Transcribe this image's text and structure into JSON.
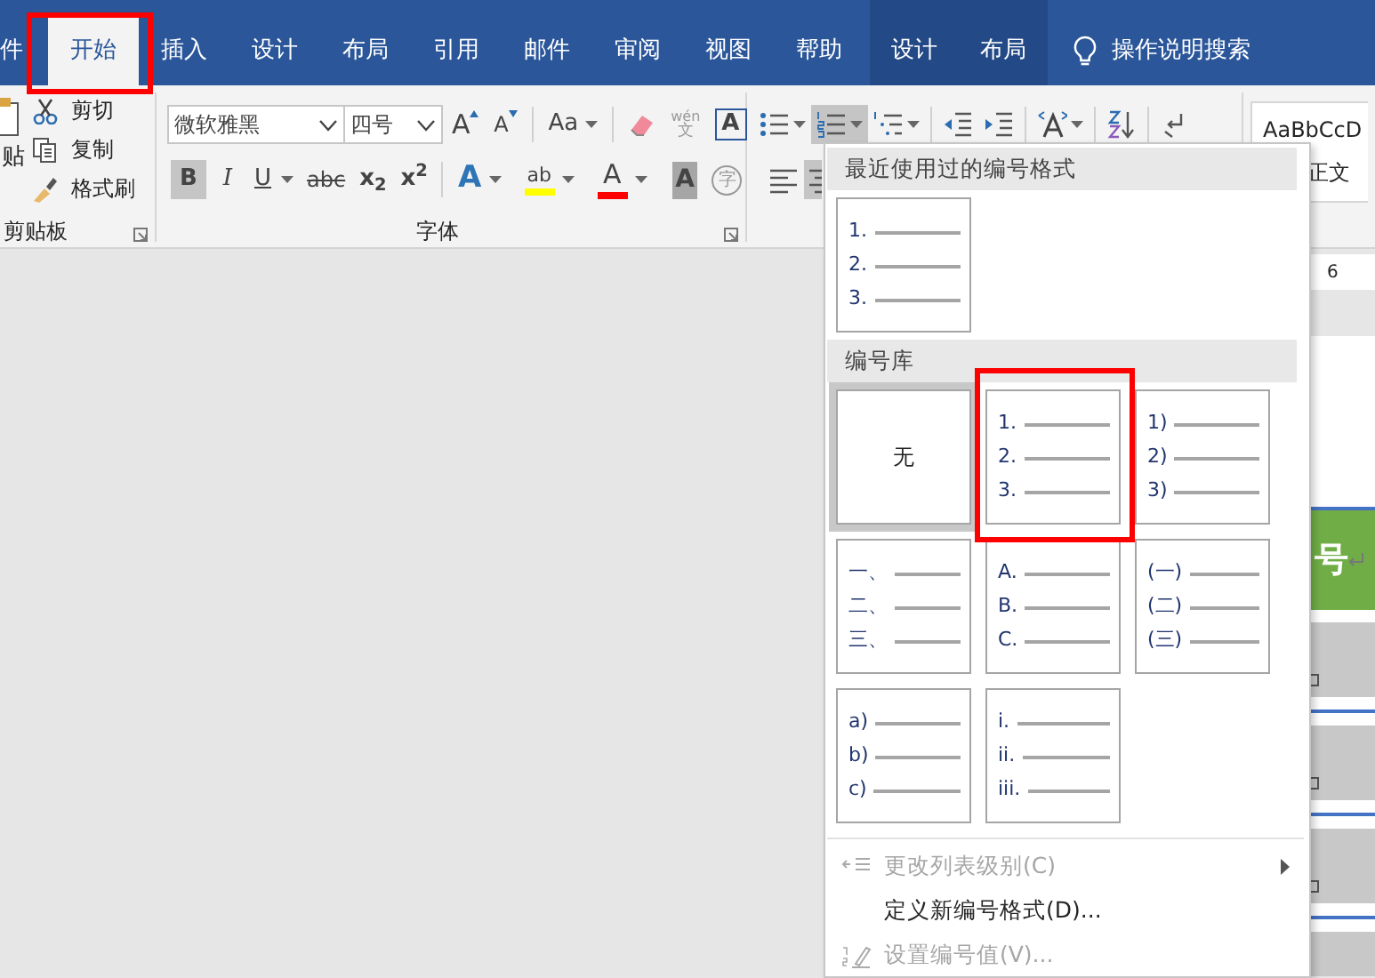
{
  "tabs": [
    {
      "label": "件",
      "selected": false,
      "kind": "tab"
    },
    {
      "label": "开始",
      "selected": true,
      "kind": "tab"
    },
    {
      "label": "插入",
      "selected": false,
      "kind": "tab"
    },
    {
      "label": "设计",
      "selected": false,
      "kind": "tab"
    },
    {
      "label": "布局",
      "selected": false,
      "kind": "tab"
    },
    {
      "label": "引用",
      "selected": false,
      "kind": "tab"
    },
    {
      "label": "邮件",
      "selected": false,
      "kind": "tab"
    },
    {
      "label": "审阅",
      "selected": false,
      "kind": "tab"
    },
    {
      "label": "视图",
      "selected": false,
      "kind": "tab"
    },
    {
      "label": "帮助",
      "selected": false,
      "kind": "tab"
    },
    {
      "label": "设计",
      "selected": false,
      "kind": "context"
    },
    {
      "label": "布局",
      "selected": false,
      "kind": "context"
    }
  ],
  "search": {
    "label": "操作说明搜索"
  },
  "clipboard": {
    "paste_label": "贴",
    "items": [
      {
        "kind": "cut",
        "label": "剪切"
      },
      {
        "kind": "copy",
        "label": "复制"
      },
      {
        "kind": "painter",
        "label": "格式刷"
      }
    ],
    "label": "剪贴板"
  },
  "font": {
    "name": "微软雅黑",
    "size": "四号",
    "label": "字体",
    "row1": [
      {
        "kind": "grow",
        "label": "A"
      },
      {
        "kind": "shrink",
        "label": "A"
      },
      {
        "kind": "case",
        "label": "Aa"
      },
      {
        "kind": "clear"
      },
      {
        "kind": "phonetic",
        "label": "wén",
        "sub": "文"
      },
      {
        "kind": "border",
        "label": "A"
      }
    ],
    "row2": [
      {
        "kind": "bold",
        "label": "B",
        "selected": true
      },
      {
        "kind": "italic",
        "label": "I",
        "selected": false
      },
      {
        "kind": "underline",
        "label": "U",
        "selected": false
      },
      {
        "kind": "strike",
        "label": "abc",
        "selected": false
      },
      {
        "kind": "subscript",
        "label": "x$_{2}$",
        "selected": false
      },
      {
        "kind": "superscript",
        "label": "x$^{2}$",
        "selected": false
      },
      {
        "kind": "effect",
        "label": "A"
      },
      {
        "kind": "highlight",
        "label": "ab",
        "color": "#ffff00"
      },
      {
        "kind": "fontcolor",
        "label": "A",
        "color": "#ff0000"
      },
      {
        "kind": "shading",
        "label": "A"
      },
      {
        "kind": "enclose",
        "label": "字"
      }
    ]
  },
  "paragraph": {
    "row1": [
      {
        "kind": "bullets",
        "selected": false
      },
      {
        "kind": "numbering",
        "selected": true
      },
      {
        "kind": "multilevel",
        "selected": false
      },
      {
        "kind": "outdent",
        "selected": false
      },
      {
        "kind": "indent",
        "selected": false
      },
      {
        "kind": "asian",
        "selected": false
      },
      {
        "kind": "sort",
        "selected": false
      },
      {
        "kind": "marks",
        "selected": false
      }
    ],
    "row2": [
      {
        "kind": "left",
        "selected": false
      },
      {
        "kind": "center",
        "selected": true
      }
    ]
  },
  "styles": {
    "preview": "AaBbCcD",
    "name": "正文"
  },
  "numbering_menu": {
    "sections": [
      {
        "title": "最近使用过的编号格式",
        "formats": [
          {
            "kind": "list",
            "markers": [
              "1.",
              "2.",
              "3."
            ],
            "selected": false
          }
        ]
      },
      {
        "title": "编号库",
        "formats": [
          {
            "kind": "none",
            "label": "无",
            "selected": true
          },
          {
            "kind": "list",
            "markers": [
              "1.",
              "2.",
              "3."
            ],
            "selected": false
          },
          {
            "kind": "list",
            "markers": [
              "1)",
              "2)",
              "3)"
            ],
            "selected": false
          },
          {
            "kind": "list",
            "markers": [
              "一、",
              "二、",
              "三、"
            ],
            "selected": false
          },
          {
            "kind": "list",
            "markers": [
              "A.",
              "B.",
              "C."
            ],
            "selected": false
          },
          {
            "kind": "list",
            "markers": [
              "(一)",
              "(二)",
              "(三)"
            ],
            "selected": false
          },
          {
            "kind": "list",
            "markers": [
              "a)",
              "b)",
              "c)"
            ],
            "selected": false
          },
          {
            "kind": "list",
            "markers": [
              "i.",
              "ii.",
              "iii."
            ],
            "selected": false
          }
        ]
      }
    ],
    "items": [
      {
        "kind": "level",
        "label": "更改列表级别(C)",
        "disabled": true,
        "submenu": true
      },
      {
        "kind": "define",
        "label": "定义新编号格式(D)...",
        "disabled": false,
        "submenu": false
      },
      {
        "kind": "value",
        "label": "设置编号值(V)...",
        "disabled": true,
        "submenu": false
      }
    ]
  },
  "document": {
    "ruler_label": "6",
    "table_header": "号",
    "rows": [
      {
        "kind": "cell"
      },
      {
        "kind": "cell"
      },
      {
        "kind": "cell"
      },
      {
        "kind": "cell"
      }
    ]
  }
}
